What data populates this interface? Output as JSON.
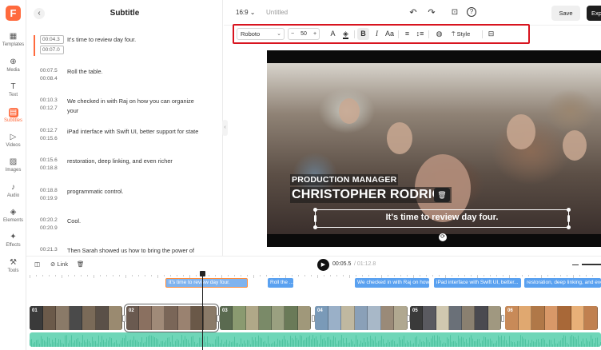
{
  "app": {
    "logo_letter": "F",
    "aspect": "16:9",
    "doc_title": "Untitled",
    "save_label": "Save",
    "export_label": "Exp"
  },
  "rail": [
    {
      "label": "Templates",
      "icon": "templates-icon"
    },
    {
      "label": "Media",
      "icon": "media-icon"
    },
    {
      "label": "Text",
      "icon": "text-icon"
    },
    {
      "label": "Subtitles",
      "icon": "subtitles-icon",
      "active": true
    },
    {
      "label": "Videos",
      "icon": "videos-icon"
    },
    {
      "label": "Images",
      "icon": "images-icon"
    },
    {
      "label": "Audio",
      "icon": "audio-icon"
    },
    {
      "label": "Elements",
      "icon": "elements-icon"
    },
    {
      "label": "Effects",
      "icon": "effects-icon"
    },
    {
      "label": "Tools",
      "icon": "tools-icon"
    }
  ],
  "panel": {
    "title": "Subtitle",
    "subtitles": [
      {
        "start": "00:04.3",
        "end": "00:07.0",
        "text": "It's time to review day four."
      },
      {
        "start": "00:07.5",
        "end": "00:08.4",
        "text": "Roll the table."
      },
      {
        "start": "00:10.3",
        "end": "00:12.7",
        "text": "We checked in with Raj on how you can organize your"
      },
      {
        "start": "00:12.7",
        "end": "00:15.6",
        "text": "iPad interface with Swift UI, better support for state"
      },
      {
        "start": "00:15.6",
        "end": "00:18.8",
        "text": "restoration, deep linking, and even richer"
      },
      {
        "start": "00:18.8",
        "end": "00:19.9",
        "text": "programmatic control."
      },
      {
        "start": "00:20.2",
        "end": "00:20.9",
        "text": "Cool."
      },
      {
        "start": "00:21.3",
        "end": "",
        "text": "Then Sarah showed us how to bring the power of"
      }
    ]
  },
  "toolbar": {
    "font": "Roboto",
    "size": "50",
    "style_label": "Style",
    "tools": [
      "text-color-icon",
      "highlight-color-icon",
      "bold-icon",
      "italic-icon",
      "case-icon",
      "align-icon",
      "line-spacing-icon",
      "opacity-icon",
      "style-icon",
      "caption-icon"
    ]
  },
  "video": {
    "lower_third_role": "PRODUCTION MANAGER",
    "lower_third_name": "CHRISTOPHER RODRICS",
    "subtitle": "It's time to review day four."
  },
  "timeline": {
    "split_label": "",
    "link_label": "Link",
    "current_time": "00:05.5",
    "total_time": "01:12.8",
    "subtitle_chips": [
      "It's time to review day four.",
      "Roll the ...",
      "We checked in with Raj on how ...",
      "iPad interface with Swift UI, better...",
      "restoration, deep linking, and even ..."
    ],
    "clips": [
      "01",
      "02",
      "03",
      "04",
      "05",
      "06"
    ]
  }
}
